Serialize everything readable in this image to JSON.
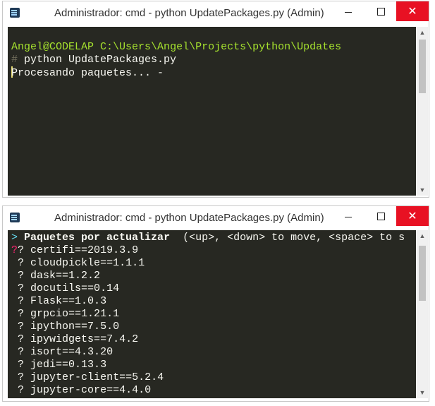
{
  "window1": {
    "title": "Administrador: cmd - python  UpdatePackages.py (Admin)",
    "prompt_user": "Angel@CODELAP",
    "prompt_path": "C:\\Users\\Angel\\Projects\\python\\Updates",
    "hash": "#",
    "command": " python UpdatePackages.py",
    "status": "Procesando paquetes... -"
  },
  "window2": {
    "title": "Administrador: cmd - python  UpdatePackages.py (Admin)",
    "pointer": ">",
    "question": "Paquetes por actualizar",
    "hint": "  (<up>, <down> to move, <space> to s",
    "first_marker": "?",
    "marker": "?",
    "packages": [
      "certifi==2019.3.9",
      "cloudpickle==1.1.1",
      "dask==1.2.2",
      "docutils==0.14",
      "Flask==1.0.3",
      "grpcio==1.21.1",
      "ipython==7.5.0",
      "ipywidgets==7.4.2",
      "isort==4.3.20",
      "jedi==0.13.3",
      "jupyter-client==5.2.4",
      "jupyter-core==4.4.0"
    ]
  },
  "controls": {
    "minimize": "—",
    "maximize": "□",
    "close": "✕"
  },
  "icons": {
    "app": "console-app-icon",
    "scroll_up": "▲",
    "scroll_down": "▼"
  },
  "colors": {
    "console_bg": "#272822",
    "prompt_green": "#a6e22e",
    "pointer_cyan": "#66d9ef",
    "marker_red": "#f92672",
    "close_red": "#e81123"
  }
}
